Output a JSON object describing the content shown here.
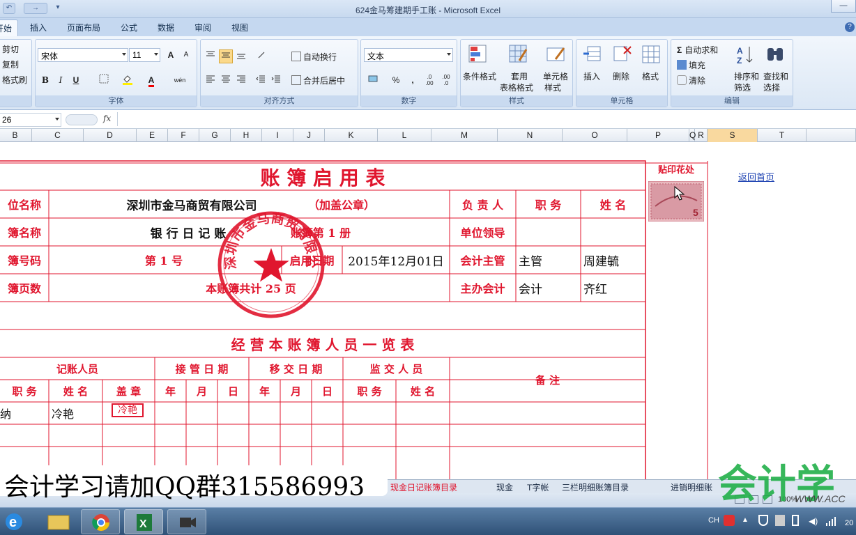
{
  "window": {
    "title": "624金马筹建期手工账 - Microsoft Excel",
    "qat": [
      "↶",
      "→",
      "▾"
    ],
    "controls": [
      "—",
      "□",
      "✕"
    ]
  },
  "tabs": [
    "开始",
    "插入",
    "页面布局",
    "公式",
    "数据",
    "审阅",
    "视图"
  ],
  "ribbon": {
    "clipboard": {
      "cut": "剪切",
      "copy": "复制",
      "format_painter": "格式刷"
    },
    "font": {
      "name": "宋体",
      "size": "11",
      "grow": "A",
      "shrink": "A",
      "bold": "B",
      "italic": "I",
      "underline": "U",
      "phonetic": "wén",
      "label": "字体"
    },
    "alignment": {
      "wrap": "自动换行",
      "merge": "合并后居中",
      "label": "对齐方式"
    },
    "number": {
      "format": "文本",
      "percent": "%",
      "comma": ",",
      "inc": ".0 .00",
      "dec": ".00 .0",
      "label": "数字"
    },
    "styles": {
      "conditional": "条件格式",
      "as_table_1": "套用",
      "as_table_2": "表格格式",
      "cell_1": "单元格",
      "cell_2": "样式",
      "label": "样式"
    },
    "cells": {
      "insert": "插入",
      "delete": "删除",
      "format": "格式",
      "label": "单元格"
    },
    "editing": {
      "autosum": "自动求和",
      "fill": "填充",
      "clear": "清除",
      "sort_1": "排序和",
      "sort_2": "筛选",
      "find_1": "查找和",
      "find_2": "选择",
      "label": "编辑"
    }
  },
  "formula_bar": {
    "name_box": "26",
    "fx": "fx",
    "value": ""
  },
  "columns": [
    "B",
    "C",
    "D",
    "E",
    "F",
    "G",
    "H",
    "I",
    "J",
    "K",
    "L",
    "M",
    "N",
    "O",
    "P",
    "Q",
    "R",
    "S",
    "T"
  ],
  "selected_column": "S",
  "sheet": {
    "title": "账    簿    启    用    表",
    "stamp_area": "贴印花处",
    "back_link": "返回首页",
    "unit_name_label": "位名称",
    "unit_name": "深圳市金马商贸有限公司",
    "seal_note": "（加盖公章）",
    "book_name_label": "簿名称",
    "book_name": "银 行 日 记 账",
    "volume": "账簿第  1  册",
    "book_no_label": "簿号码",
    "book_no": "第    1    号",
    "start_date_label": "启用日期",
    "start_date": "2015年12月01日",
    "pages_label": "簿页数",
    "pages": "本账簿共计  25   页",
    "resp_person": "负 责 人",
    "position": "职  务",
    "name": "姓  名",
    "unit_leader": "单位领导",
    "chief_accountant": "会计主管",
    "chief_position": "主管",
    "chief_name": "周建毓",
    "main_accountant": "主办会计",
    "main_position": "会计",
    "main_name": "齐红",
    "staff_title": "经    营    本    账    簿    人    员    一    览    表",
    "bookkeeper": "记账人员",
    "handover": "接   管   日   期",
    "transfer": "移   交   日   期",
    "supervisor": "监   交   人   员",
    "remarks": "备        注",
    "col_position": "职    务",
    "col_name": "姓  名",
    "col_seal": "盖  章",
    "year": "年",
    "month": "月",
    "day": "日",
    "sup_position": "职  务",
    "sup_name": "姓  名",
    "row1_position": "纳",
    "row1_name": "冷艳",
    "row1_seal": "冷艳",
    "company_seal_text": "深圳市金马商贸有限公司"
  },
  "sheet_tabs": [
    "现金日记账簿目录",
    "现金",
    "T字帐",
    "三栏明细账簿目录",
    "进销明细账"
  ],
  "overlay_text": "会计学习请加QQ群315586993",
  "watermark": "会计学",
  "watermark_url": "WWW.ACC",
  "status": {
    "zoom": "100%"
  },
  "taskbar": {
    "lang": "CH",
    "time": "20"
  },
  "colors": {
    "red": "#e0162e",
    "ribbon": "#dbe7f5",
    "selected": "#f9d99f"
  }
}
